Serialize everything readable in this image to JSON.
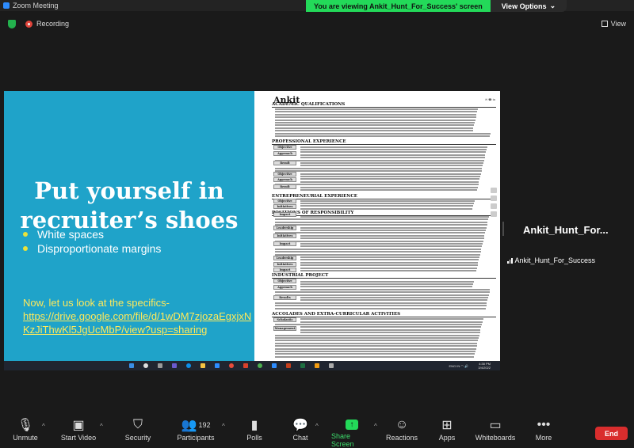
{
  "window": {
    "title": "Zoom Meeting"
  },
  "banner": {
    "message": "You are viewing Ankit_Hunt_For_Success' screen",
    "view_options": "View Options"
  },
  "status": {
    "recording_label": "Recording",
    "view_label": "View"
  },
  "slide": {
    "heading": "Put yourself in recruiter’s shoes",
    "bullets": [
      "White spaces",
      "Disproportionate margins"
    ],
    "lead": "Now, let us look at the specifics-",
    "link": "https://drive.google.com/file/d/1wDM7zjozaEgxjxNKzJiThwKl5JgUcMbP/view?usp=sharing"
  },
  "resume": {
    "name": "Ankit",
    "sections": [
      "ACADEMIC QUALIFICATIONS",
      "PROFESSIONAL EXPERIENCE",
      "ENTREPRENEURIAL EXPERIENCE",
      "POSITIONS OF RESPONSIBILITY",
      "INDUSTRIAL PROJECT",
      "ACCOLADES AND EXTRA-CURRICULAR ACTIVITIES"
    ],
    "row_labels": [
      "Objective",
      "Approach",
      "Result",
      "Objective",
      "Approach",
      "Result",
      "Objective",
      "Initiatives",
      "Impact",
      "Leadership",
      "Initiatives",
      "Impact",
      "Leadership",
      "Initiatives",
      "Impact",
      "Objective",
      "Approach",
      "Results",
      "Scholastic",
      "Management"
    ]
  },
  "taskbar": {
    "time": "4:38 PM",
    "date": "3/4/2022",
    "lang": "ENG",
    "region": "IN"
  },
  "participant": {
    "tile_name": "Ankit_Hunt_For...",
    "full_name": "Ankit_Hunt_For_Success"
  },
  "toolbar": {
    "unmute": "Unmute",
    "start_video": "Start Video",
    "security": "Security",
    "participants": "Participants",
    "participants_count": "192",
    "polls": "Polls",
    "chat": "Chat",
    "share_screen": "Share Screen",
    "reactions": "Reactions",
    "apps": "Apps",
    "whiteboards": "Whiteboards",
    "more": "More",
    "end": "End"
  },
  "colors": {
    "slide_bg": "#1fa3c9",
    "highlight": "#ffe95a",
    "share_green": "#23d959",
    "end_red": "#d92d2d"
  }
}
